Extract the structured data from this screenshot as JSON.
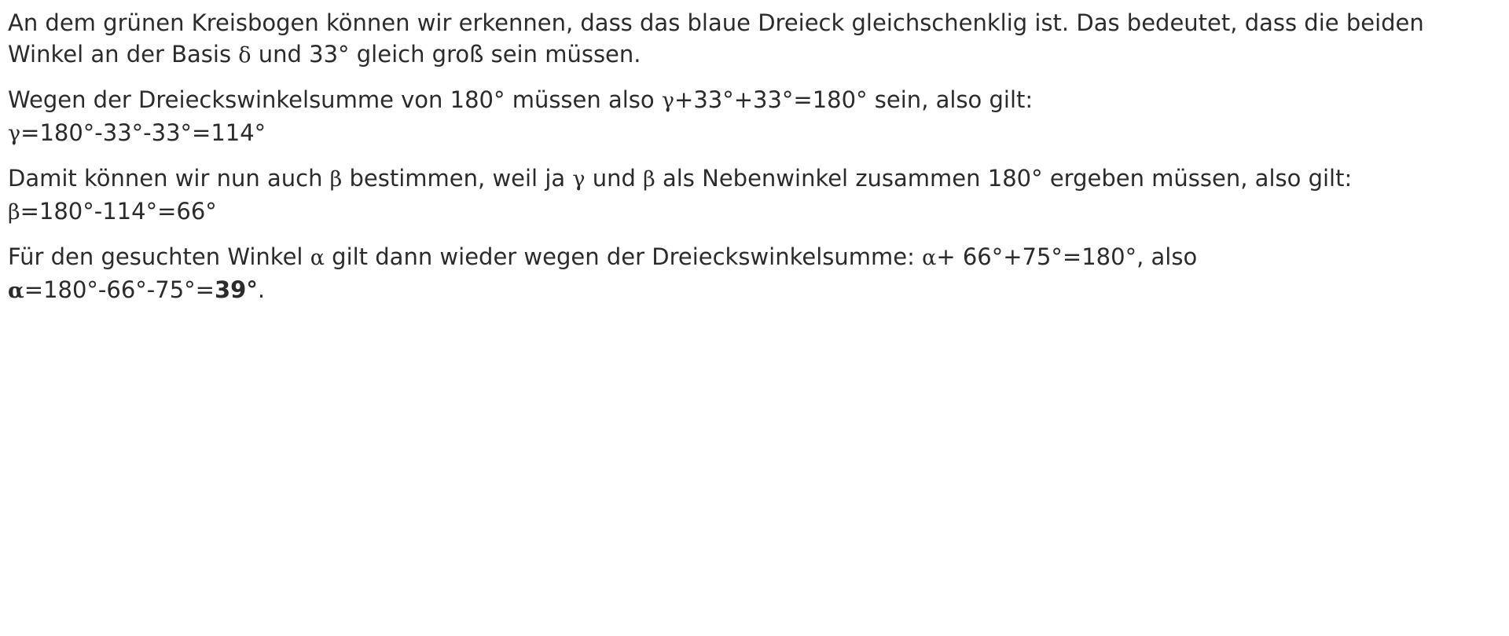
{
  "solution": {
    "p1": {
      "l1": "An dem grünen Kreisbogen können wir erkennen, dass das blaue Dreieck gleichschenklig ist. Das bedeutet, dass die beiden",
      "l2_a": "Winkel an der Basis ",
      "delta": "δ",
      "l2_b": " und 33° gleich groß sein müssen."
    },
    "p2": {
      "l1_a": "Wegen der Dreieckswinkelsumme von 180° müssen also ",
      "gamma": "γ",
      "l1_b": "+33°+33°=180° sein, also gilt:",
      "l2_gamma": "γ",
      "l2_b": "=180°-33°-33°=114°"
    },
    "p3": {
      "l1_a": "Damit können wir nun auch ",
      "beta1": "β",
      "l1_b": " bestimmen, weil ja ",
      "gamma": "γ",
      "l1_c": " und ",
      "beta2": "β",
      "l1_d": " als Nebenwinkel zusammen 180° ergeben müssen, also gilt:",
      "l2_beta": "β",
      "l2_b": "=180°-114°=66°"
    },
    "p4": {
      "l1_a": "Für den gesuchten Winkel ",
      "alpha1": "α",
      "l1_b": " gilt dann wieder wegen der Dreieckswinkelsumme: ",
      "alpha2": "α",
      "l1_c": "+ 66°+75°=180°, also",
      "l2_alpha": "α",
      "l2_b": "=180°-66°-75°=",
      "result": "39°",
      "l2_end": "."
    }
  }
}
